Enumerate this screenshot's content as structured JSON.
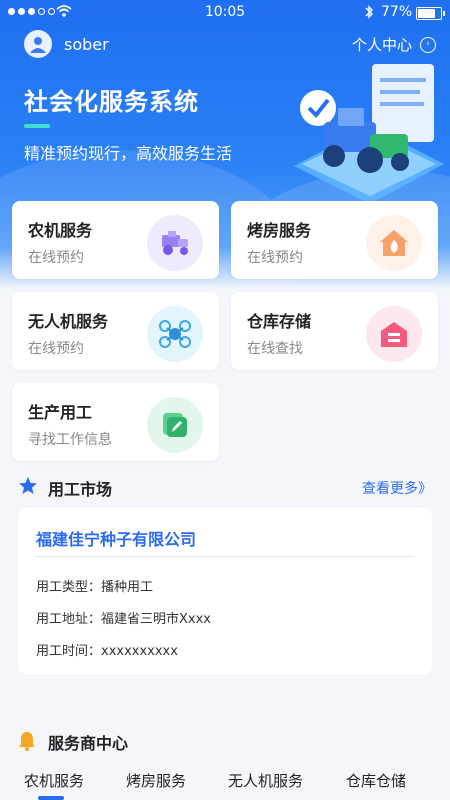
{
  "status_bar": {
    "time": "10:05",
    "battery_percent": "77%"
  },
  "header": {
    "username": "sober",
    "center_link": "个人中心",
    "title": "社会化服务系统",
    "subtitle": "精准预约现行，高效服务生活"
  },
  "services": [
    {
      "title": "农机服务",
      "subtitle": "在线预约",
      "icon": "tractor-icon",
      "color": "#8a6cf0",
      "bg": "#efeafd"
    },
    {
      "title": "烤房服务",
      "subtitle": "在线预约",
      "icon": "house-fire-icon",
      "color": "#f5884b",
      "bg": "#fdf1e8"
    },
    {
      "title": "无人机服务",
      "subtitle": "在线预约",
      "icon": "drone-icon",
      "color": "#26a7e8",
      "bg": "#e4f4fd"
    },
    {
      "title": "仓库存储",
      "subtitle": "在线查找",
      "icon": "warehouse-icon",
      "color": "#f24d72",
      "bg": "#fde8ee"
    },
    {
      "title": "生产用工",
      "subtitle": "寻找工作信息",
      "icon": "edit-icon",
      "color": "#2db36b",
      "bg": "#e3f6ec"
    }
  ],
  "labor_market": {
    "title": "用工市场",
    "more": "查看更多》",
    "job": {
      "company": "福建佳宁种子有限公司",
      "type": "用工类型：播种用工",
      "address": "用工地址：福建省三明市Xxxx",
      "time": "用工时间：xxxxxxxxxx"
    }
  },
  "provider_center": {
    "title": "服务商中心",
    "tabs": [
      "农机服务",
      "烤房服务",
      "无人机服务",
      "仓库仓储"
    ]
  },
  "colors": {
    "primary": "#2a6cf0",
    "accent_line": "#3ee0d0"
  }
}
